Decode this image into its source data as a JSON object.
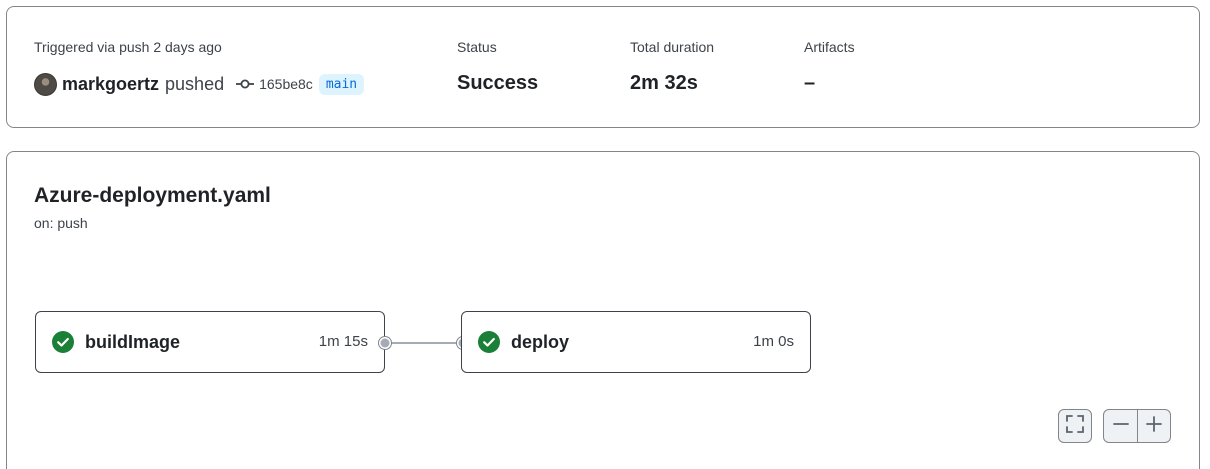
{
  "summary": {
    "trigger_text": "Triggered via push 2 days ago",
    "actor": "markgoertz",
    "action": "pushed",
    "commit_sha": "165be8c",
    "branch": "main",
    "status_label": "Status",
    "status_value": "Success",
    "duration_label": "Total duration",
    "duration_value": "2m 32s",
    "artifacts_label": "Artifacts",
    "artifacts_value": "–",
    "icons": {
      "avatar": "user-avatar",
      "commit": "git-commit-icon"
    }
  },
  "workflow": {
    "file": "Azure-deployment.yaml",
    "trigger": "on: push",
    "jobs": [
      {
        "name": "buildImage",
        "duration": "1m 15s",
        "status": "success"
      },
      {
        "name": "deploy",
        "duration": "1m 0s",
        "status": "success"
      }
    ],
    "controls": {
      "fit_icon": "fullscreen-icon",
      "zoom_out_icon": "minus-icon",
      "zoom_in_icon": "plus-icon"
    }
  },
  "colors": {
    "success": "#1a7f37",
    "branch_bg": "#ddf4ff",
    "branch_fg": "#0969da",
    "connector": "#a4abb4"
  }
}
